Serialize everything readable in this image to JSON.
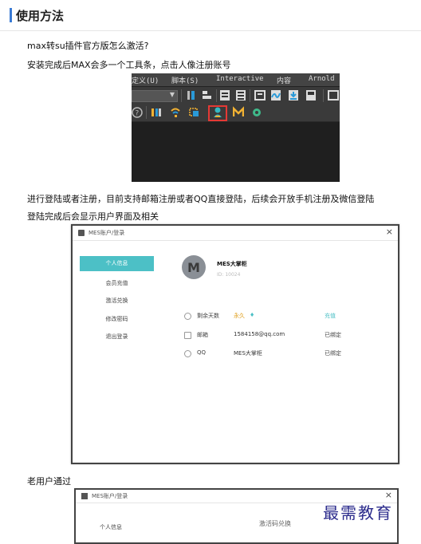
{
  "header": {
    "title": "使用方法"
  },
  "paragraphs": {
    "p1": "max转su插件官方版怎么激活?",
    "p2": "安装完成后MAX会多一个工具条，点击人像注册账号",
    "p3": "进行登陆或者注册，目前支持邮箱注册或者QQ直接登陆，后续会开放手机注册及微信登陆",
    "p4": "登陆完成后会显示用户界面及相关",
    "p5": "老用户通过"
  },
  "max_screenshot": {
    "menu": [
      "定义(U)",
      "脚本(S)",
      "Interactive",
      "内容",
      "Arnold"
    ]
  },
  "dialog": {
    "title": "MES账户/登录",
    "close": "×",
    "nav": [
      "个人信息",
      "会员充值",
      "激活兑换",
      "修改密码",
      "退出登录"
    ],
    "avatar_letter": "M",
    "username": "MES大掌柜",
    "user_id": "ID: 10024",
    "rows": [
      {
        "label": "剩余天数",
        "value": "永久",
        "action": "充值"
      },
      {
        "label": "邮箱",
        "value": "1584158@qq.com",
        "action": "已绑定"
      },
      {
        "label": "QQ",
        "value": "MES大掌柜",
        "action": "已绑定"
      }
    ]
  },
  "dialog2": {
    "title": "MES账户/登录",
    "close": "×",
    "nav_first": "个人信息",
    "main_title": "激活码兑换"
  },
  "watermark": "最需教育",
  "colors": {
    "accent": "#3a7bd5",
    "nav_active": "#4cc0c6",
    "highlight_box": "#e53935"
  }
}
